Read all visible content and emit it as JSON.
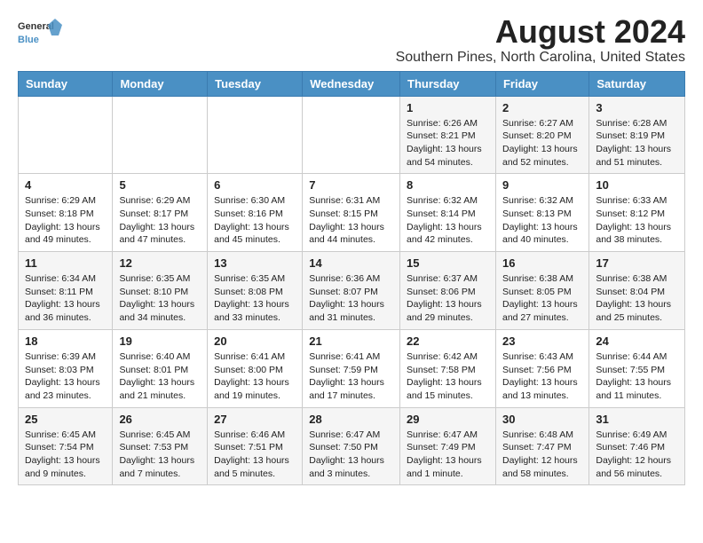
{
  "logo": {
    "text_general": "General",
    "text_blue": "Blue"
  },
  "title": "August 2024",
  "location": "Southern Pines, North Carolina, United States",
  "weekdays": [
    "Sunday",
    "Monday",
    "Tuesday",
    "Wednesday",
    "Thursday",
    "Friday",
    "Saturday"
  ],
  "weeks": [
    [
      {
        "day": "",
        "sunrise": "",
        "sunset": "",
        "daylight": ""
      },
      {
        "day": "",
        "sunrise": "",
        "sunset": "",
        "daylight": ""
      },
      {
        "day": "",
        "sunrise": "",
        "sunset": "",
        "daylight": ""
      },
      {
        "day": "",
        "sunrise": "",
        "sunset": "",
        "daylight": ""
      },
      {
        "day": "1",
        "sunrise": "Sunrise: 6:26 AM",
        "sunset": "Sunset: 8:21 PM",
        "daylight": "Daylight: 13 hours and 54 minutes."
      },
      {
        "day": "2",
        "sunrise": "Sunrise: 6:27 AM",
        "sunset": "Sunset: 8:20 PM",
        "daylight": "Daylight: 13 hours and 52 minutes."
      },
      {
        "day": "3",
        "sunrise": "Sunrise: 6:28 AM",
        "sunset": "Sunset: 8:19 PM",
        "daylight": "Daylight: 13 hours and 51 minutes."
      }
    ],
    [
      {
        "day": "4",
        "sunrise": "Sunrise: 6:29 AM",
        "sunset": "Sunset: 8:18 PM",
        "daylight": "Daylight: 13 hours and 49 minutes."
      },
      {
        "day": "5",
        "sunrise": "Sunrise: 6:29 AM",
        "sunset": "Sunset: 8:17 PM",
        "daylight": "Daylight: 13 hours and 47 minutes."
      },
      {
        "day": "6",
        "sunrise": "Sunrise: 6:30 AM",
        "sunset": "Sunset: 8:16 PM",
        "daylight": "Daylight: 13 hours and 45 minutes."
      },
      {
        "day": "7",
        "sunrise": "Sunrise: 6:31 AM",
        "sunset": "Sunset: 8:15 PM",
        "daylight": "Daylight: 13 hours and 44 minutes."
      },
      {
        "day": "8",
        "sunrise": "Sunrise: 6:32 AM",
        "sunset": "Sunset: 8:14 PM",
        "daylight": "Daylight: 13 hours and 42 minutes."
      },
      {
        "day": "9",
        "sunrise": "Sunrise: 6:32 AM",
        "sunset": "Sunset: 8:13 PM",
        "daylight": "Daylight: 13 hours and 40 minutes."
      },
      {
        "day": "10",
        "sunrise": "Sunrise: 6:33 AM",
        "sunset": "Sunset: 8:12 PM",
        "daylight": "Daylight: 13 hours and 38 minutes."
      }
    ],
    [
      {
        "day": "11",
        "sunrise": "Sunrise: 6:34 AM",
        "sunset": "Sunset: 8:11 PM",
        "daylight": "Daylight: 13 hours and 36 minutes."
      },
      {
        "day": "12",
        "sunrise": "Sunrise: 6:35 AM",
        "sunset": "Sunset: 8:10 PM",
        "daylight": "Daylight: 13 hours and 34 minutes."
      },
      {
        "day": "13",
        "sunrise": "Sunrise: 6:35 AM",
        "sunset": "Sunset: 8:08 PM",
        "daylight": "Daylight: 13 hours and 33 minutes."
      },
      {
        "day": "14",
        "sunrise": "Sunrise: 6:36 AM",
        "sunset": "Sunset: 8:07 PM",
        "daylight": "Daylight: 13 hours and 31 minutes."
      },
      {
        "day": "15",
        "sunrise": "Sunrise: 6:37 AM",
        "sunset": "Sunset: 8:06 PM",
        "daylight": "Daylight: 13 hours and 29 minutes."
      },
      {
        "day": "16",
        "sunrise": "Sunrise: 6:38 AM",
        "sunset": "Sunset: 8:05 PM",
        "daylight": "Daylight: 13 hours and 27 minutes."
      },
      {
        "day": "17",
        "sunrise": "Sunrise: 6:38 AM",
        "sunset": "Sunset: 8:04 PM",
        "daylight": "Daylight: 13 hours and 25 minutes."
      }
    ],
    [
      {
        "day": "18",
        "sunrise": "Sunrise: 6:39 AM",
        "sunset": "Sunset: 8:03 PM",
        "daylight": "Daylight: 13 hours and 23 minutes."
      },
      {
        "day": "19",
        "sunrise": "Sunrise: 6:40 AM",
        "sunset": "Sunset: 8:01 PM",
        "daylight": "Daylight: 13 hours and 21 minutes."
      },
      {
        "day": "20",
        "sunrise": "Sunrise: 6:41 AM",
        "sunset": "Sunset: 8:00 PM",
        "daylight": "Daylight: 13 hours and 19 minutes."
      },
      {
        "day": "21",
        "sunrise": "Sunrise: 6:41 AM",
        "sunset": "Sunset: 7:59 PM",
        "daylight": "Daylight: 13 hours and 17 minutes."
      },
      {
        "day": "22",
        "sunrise": "Sunrise: 6:42 AM",
        "sunset": "Sunset: 7:58 PM",
        "daylight": "Daylight: 13 hours and 15 minutes."
      },
      {
        "day": "23",
        "sunrise": "Sunrise: 6:43 AM",
        "sunset": "Sunset: 7:56 PM",
        "daylight": "Daylight: 13 hours and 13 minutes."
      },
      {
        "day": "24",
        "sunrise": "Sunrise: 6:44 AM",
        "sunset": "Sunset: 7:55 PM",
        "daylight": "Daylight: 13 hours and 11 minutes."
      }
    ],
    [
      {
        "day": "25",
        "sunrise": "Sunrise: 6:45 AM",
        "sunset": "Sunset: 7:54 PM",
        "daylight": "Daylight: 13 hours and 9 minutes."
      },
      {
        "day": "26",
        "sunrise": "Sunrise: 6:45 AM",
        "sunset": "Sunset: 7:53 PM",
        "daylight": "Daylight: 13 hours and 7 minutes."
      },
      {
        "day": "27",
        "sunrise": "Sunrise: 6:46 AM",
        "sunset": "Sunset: 7:51 PM",
        "daylight": "Daylight: 13 hours and 5 minutes."
      },
      {
        "day": "28",
        "sunrise": "Sunrise: 6:47 AM",
        "sunset": "Sunset: 7:50 PM",
        "daylight": "Daylight: 13 hours and 3 minutes."
      },
      {
        "day": "29",
        "sunrise": "Sunrise: 6:47 AM",
        "sunset": "Sunset: 7:49 PM",
        "daylight": "Daylight: 13 hours and 1 minute."
      },
      {
        "day": "30",
        "sunrise": "Sunrise: 6:48 AM",
        "sunset": "Sunset: 7:47 PM",
        "daylight": "Daylight: 12 hours and 58 minutes."
      },
      {
        "day": "31",
        "sunrise": "Sunrise: 6:49 AM",
        "sunset": "Sunset: 7:46 PM",
        "daylight": "Daylight: 12 hours and 56 minutes."
      }
    ]
  ]
}
